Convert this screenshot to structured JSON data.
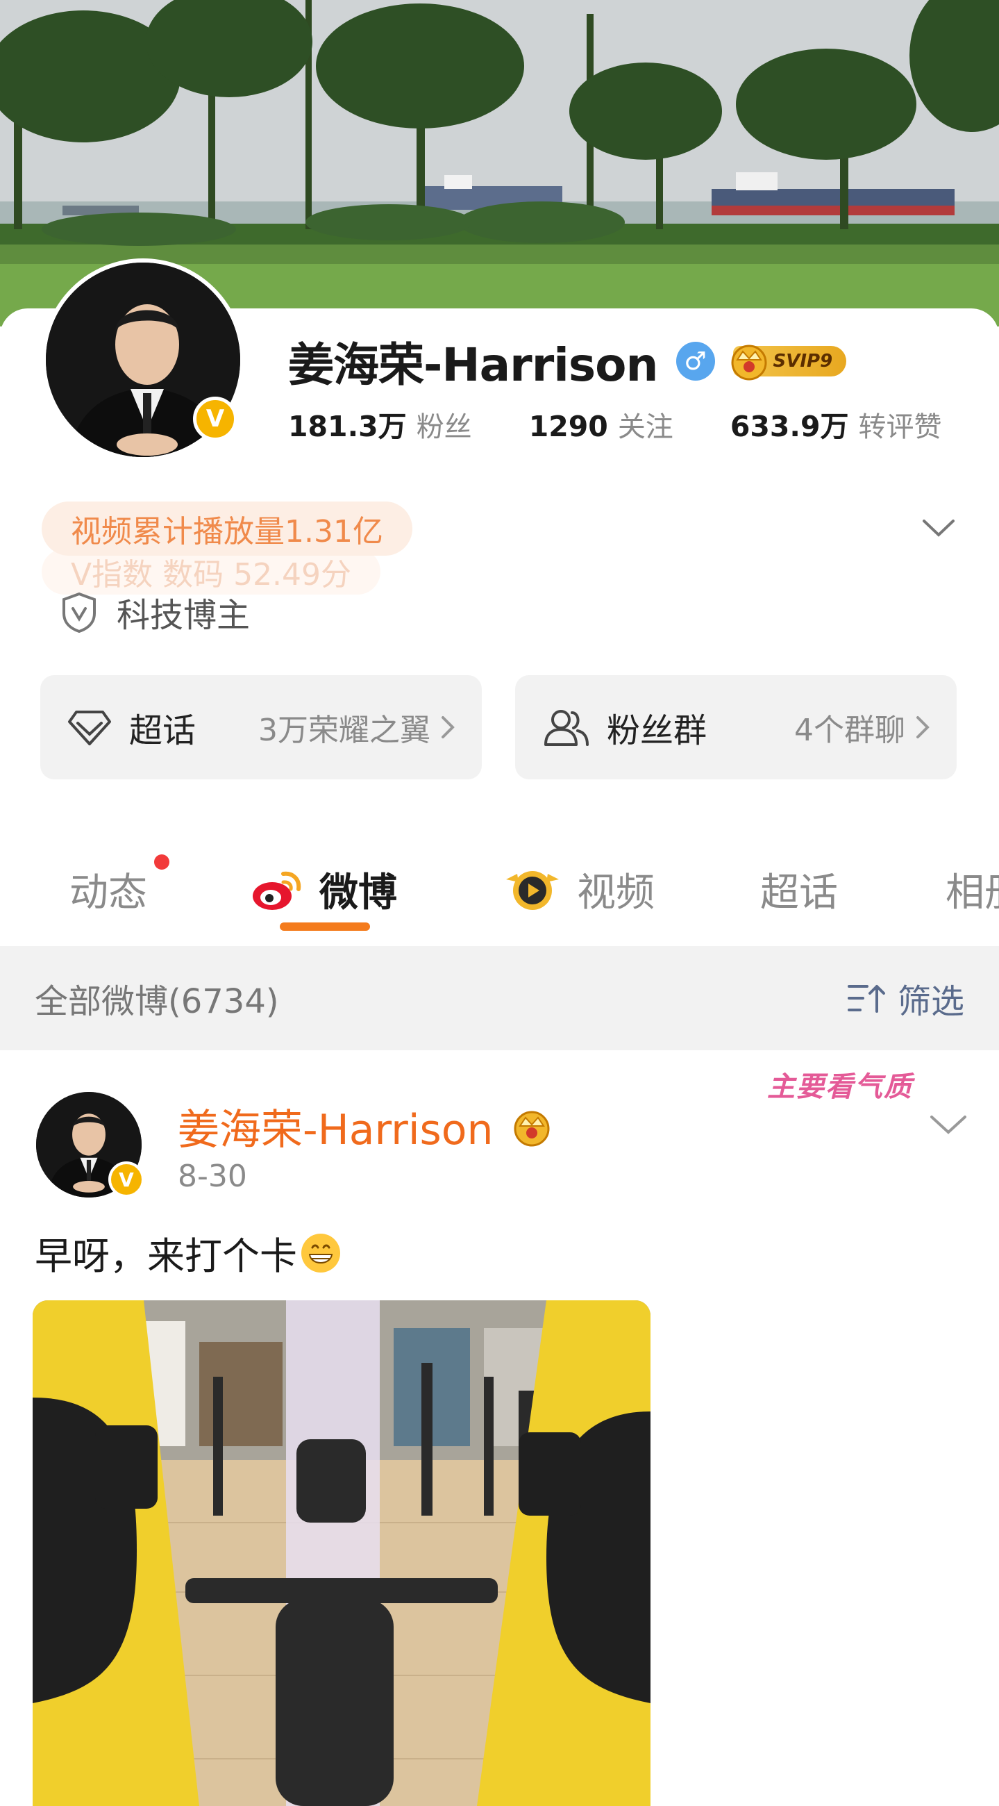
{
  "profile": {
    "name": "姜海荣-Harrison",
    "gender_symbol": "♂",
    "vip_badge": "SVIP9",
    "verified_symbol": "V",
    "stats": [
      {
        "value": "181.3万",
        "label": "粉丝"
      },
      {
        "value": "1290",
        "label": "关注"
      },
      {
        "value": "633.9万",
        "label": "转评赞"
      }
    ],
    "highlight": "视频累计播放量1.31亿",
    "highlight_ghost": "V指数 数码 52.49分",
    "tag": "科技博主"
  },
  "tiles": {
    "super_topic": {
      "label": "超话",
      "sub": "3万荣耀之翼"
    },
    "fan_group": {
      "label": "粉丝群",
      "sub": "4个群聊"
    }
  },
  "tabs": [
    {
      "label": "动态"
    },
    {
      "label": "微博"
    },
    {
      "label": "视频"
    },
    {
      "label": "超话"
    },
    {
      "label": "相册"
    }
  ],
  "active_tab": "微博",
  "filter_bar": {
    "count_label": "全部微博(6734)",
    "filter_label": "筛选"
  },
  "post": {
    "author": "姜海荣-Harrison",
    "date": "8-30",
    "text": "早呀，来打个卡",
    "emoji": "grin-emoji",
    "sticker": "主要看气质"
  },
  "colors": {
    "accent_orange": "#f47b1c",
    "name_orange": "#f06a1c",
    "verified_yellow": "#f6b400",
    "gender_blue": "#58a6ee",
    "notification_red": "#f23a3a"
  }
}
